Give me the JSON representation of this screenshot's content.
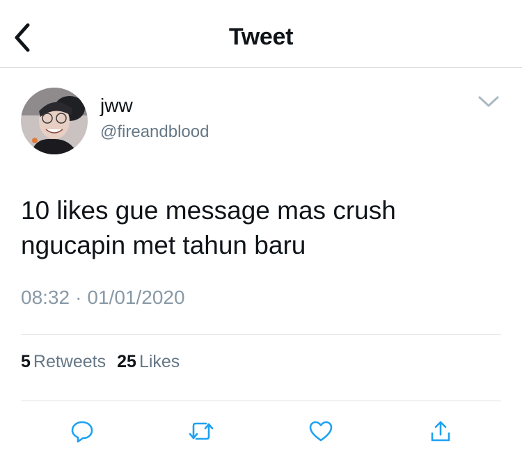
{
  "header": {
    "title": "Tweet",
    "back_icon": "chevron-left-icon"
  },
  "tweet": {
    "author": {
      "display_name": "jww",
      "handle": "@fireandblood",
      "avatar": "avatar"
    },
    "text": "10 likes gue message mas crush ngucapin met tahun baru",
    "time": "08:32",
    "separator": "·",
    "date": "01/01/2020",
    "more_icon": "chevron-down-icon"
  },
  "stats": {
    "retweets_count": "5",
    "retweets_label": "Retweets",
    "likes_count": "25",
    "likes_label": "Likes"
  },
  "actions": [
    {
      "icon": "reply-icon"
    },
    {
      "icon": "retweet-icon"
    },
    {
      "icon": "like-icon"
    },
    {
      "icon": "share-icon"
    }
  ],
  "colors": {
    "primary_text": "#0f1419",
    "secondary_text": "#657786",
    "muted_text": "#8899a6",
    "icon_blue": "#1da1f2",
    "divider": "#d7dbdf"
  }
}
